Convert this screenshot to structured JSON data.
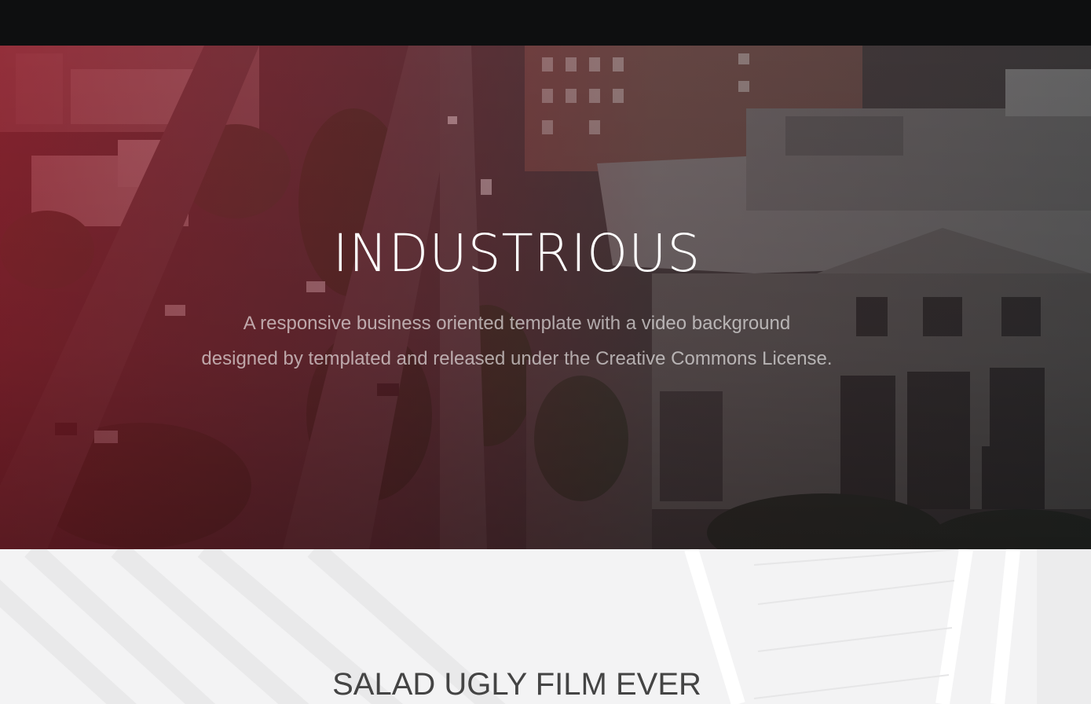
{
  "topbar": {},
  "hero": {
    "title": "INDUSTRIOUS",
    "subtitle_line1": "A responsive business oriented template with a video background",
    "subtitle_line2": "designed by templated and released under the Creative Commons License.",
    "background_icon": "aerial-city-video-background",
    "gradient_colors": [
      "#961a28",
      "#3c1e22",
      "#1e1e20"
    ]
  },
  "section2": {
    "title": "SALAD UGLY FILM EVER",
    "background_icon": "architecture-background",
    "background_color": "#f3f3f4"
  }
}
